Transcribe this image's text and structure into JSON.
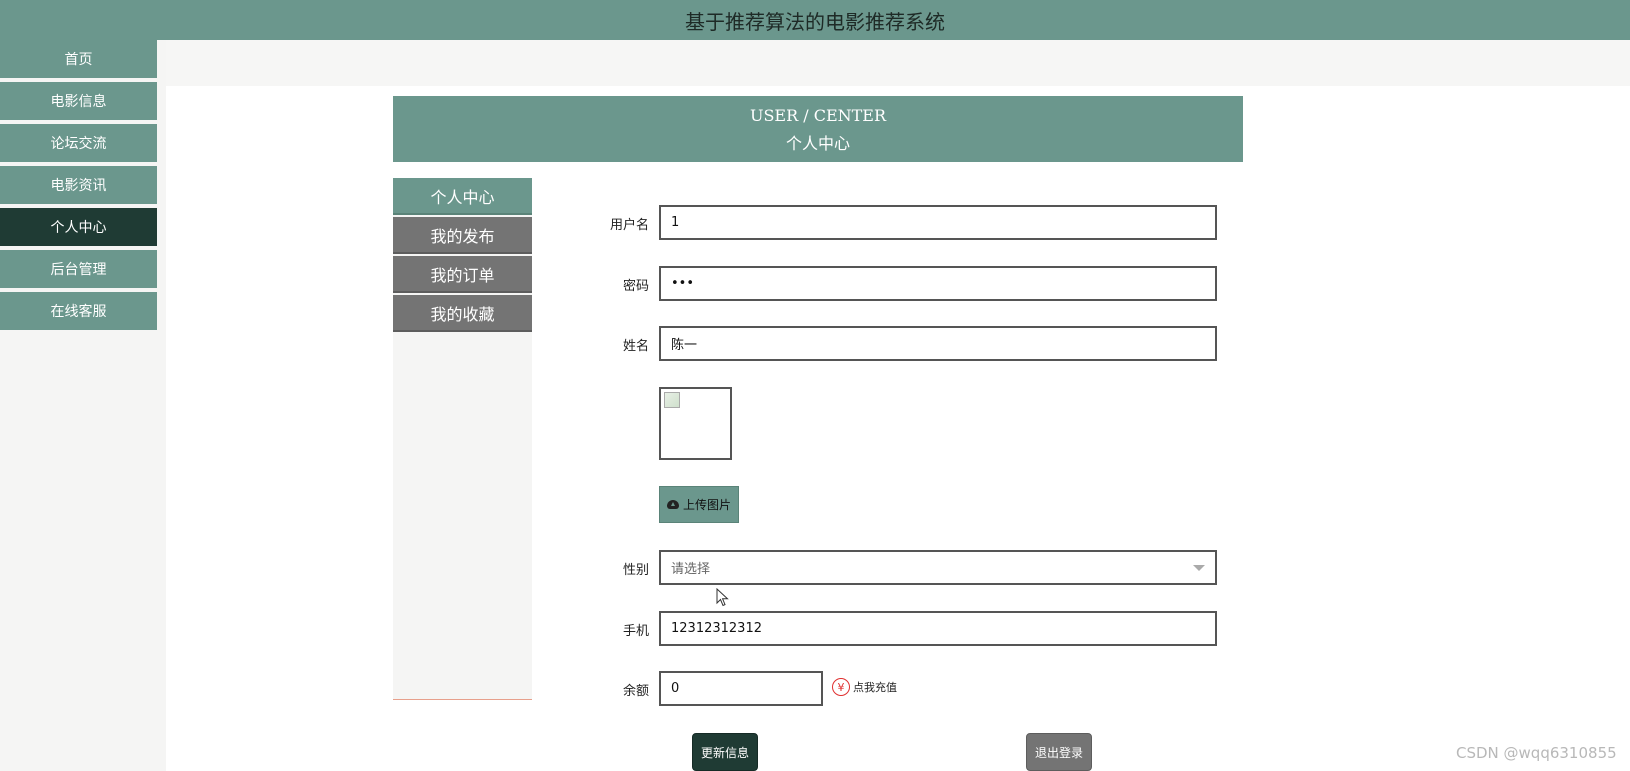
{
  "header": {
    "title": "基于推荐算法的电影推荐系统"
  },
  "nav": {
    "items": [
      {
        "label": "首页"
      },
      {
        "label": "电影信息"
      },
      {
        "label": "论坛交流"
      },
      {
        "label": "电影资讯"
      },
      {
        "label": "个人中心",
        "active": true
      },
      {
        "label": "后台管理"
      },
      {
        "label": "在线客服"
      }
    ]
  },
  "user_center": {
    "title_en": "USER / CENTER",
    "title_cn": "个人中心",
    "tabs": [
      {
        "label": "个人中心",
        "active": true
      },
      {
        "label": "我的发布"
      },
      {
        "label": "我的订单"
      },
      {
        "label": "我的收藏"
      }
    ]
  },
  "form": {
    "username": {
      "label": "用户名",
      "value": "1"
    },
    "password": {
      "label": "密码",
      "value": "•••"
    },
    "name": {
      "label": "姓名",
      "value": "陈一"
    },
    "upload_label": "上传图片",
    "gender": {
      "label": "性别",
      "placeholder": "请选择"
    },
    "phone": {
      "label": "手机",
      "value": "12312312312"
    },
    "balance": {
      "label": "余额",
      "value": "0",
      "recharge_label": "点我充值",
      "recharge_icon": "¥"
    }
  },
  "actions": {
    "update_label": "更新信息",
    "logout_label": "退出登录"
  },
  "watermark": "CSDN @wqq6310855",
  "colors": {
    "primary": "#6b978d",
    "active": "#1f3b34",
    "tab_inactive": "#747474",
    "accent_red": "#e03030"
  }
}
